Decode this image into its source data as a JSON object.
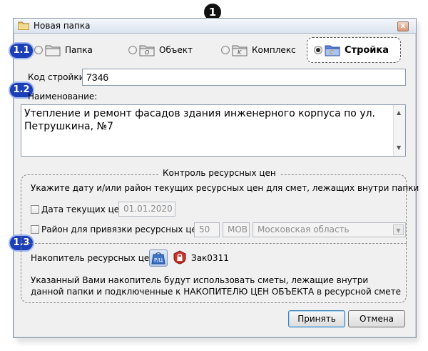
{
  "window": {
    "title": "Новая папка",
    "close_glyph": "x"
  },
  "callouts": {
    "c1": "1",
    "c1_1": "1.1",
    "c1_2": "1.2",
    "c1_3": "1.3"
  },
  "types": [
    {
      "label": "Папка",
      "selected": false,
      "icon": "folder-icon"
    },
    {
      "label": "Объект",
      "selected": false,
      "icon": "object-folder-icon"
    },
    {
      "label": "Комплекс",
      "selected": false,
      "icon": "complex-folder-icon"
    },
    {
      "label": "Стройка",
      "selected": true,
      "icon": "construction-folder-icon"
    }
  ],
  "code": {
    "label": "Код стройки:",
    "value": "7346"
  },
  "name": {
    "label": "Наименование:",
    "value": "Утепление и ремонт фасадов здания инженерного корпуса по ул. Петрушкина, №7"
  },
  "resource": {
    "legend": "Контроль ресурсных цен",
    "hint": "Укажите дату и/или район текущих ресурсных цен для смет, лежащих внутри папки",
    "date_label": "Дата текущих цен:",
    "date_value": "01.01.2020",
    "region_label": "Район для привязки ресурсных цен:",
    "region_code": "50",
    "region_abbr": "МОВ",
    "region_name": "Московская область",
    "accumulator_label": "Накопитель ресурсных цен:",
    "accumulator_value": "Зак0311",
    "accumulator_icon_text": "P/Ц",
    "note": "Указанный Вами накопитель будут использовать сметы, лежащие внутри данной папки и подключенные к НАКОПИТЕЛЮ ЦЕН ОБЪЕКТА в ресурсной смете"
  },
  "buttons": {
    "ok": "Принять",
    "cancel": "Отмена"
  },
  "colors": {
    "callout": "#1c3fb7",
    "window_bg": "#f0f0f0",
    "accent_border": "#3c7fb1"
  }
}
